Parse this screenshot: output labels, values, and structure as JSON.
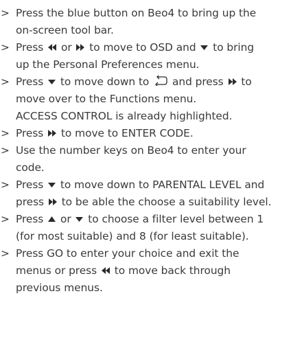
{
  "marker": ">",
  "icons": {
    "rewind": "rewind-double-left-icon",
    "forward": "fast-forward-double-right-icon",
    "down": "down-triangle-icon",
    "up": "up-triangle-icon",
    "functions": "functions-return-arrow-icon"
  },
  "steps": [
    {
      "lines": [
        [
          {
            "t": "Press the blue button on Beo4 to bring up the"
          }
        ],
        [
          {
            "t": "on-screen tool bar."
          }
        ]
      ]
    },
    {
      "lines": [
        [
          {
            "t": "Press "
          },
          {
            "i": "rewind"
          },
          {
            "t": " or "
          },
          {
            "i": "forward"
          },
          {
            "t": " to move to OSD and "
          },
          {
            "i": "down"
          },
          {
            "t": " to bring"
          }
        ],
        [
          {
            "t": "up the Personal Preferences menu."
          }
        ]
      ]
    },
    {
      "lines": [
        [
          {
            "t": "Press "
          },
          {
            "i": "down"
          },
          {
            "t": " to move down to "
          },
          {
            "i": "functions"
          },
          {
            "t": " and press "
          },
          {
            "i": "forward"
          },
          {
            "t": " to"
          }
        ],
        [
          {
            "t": "move over to the Functions menu."
          }
        ],
        [
          {
            "t": "ACCESS CONTROL is already highlighted."
          }
        ]
      ]
    },
    {
      "lines": [
        [
          {
            "t": "Press "
          },
          {
            "i": "forward"
          },
          {
            "t": " to move to ENTER CODE."
          }
        ]
      ]
    },
    {
      "lines": [
        [
          {
            "t": "Use the number keys on Beo4 to enter your"
          }
        ],
        [
          {
            "t": "code."
          }
        ]
      ]
    },
    {
      "lines": [
        [
          {
            "t": "Press "
          },
          {
            "i": "down"
          },
          {
            "t": " to move down to PARENTAL LEVEL and"
          }
        ],
        [
          {
            "t": "press "
          },
          {
            "i": "forward"
          },
          {
            "t": " to be able the choose a suitability level."
          }
        ]
      ]
    },
    {
      "lines": [
        [
          {
            "t": "Press "
          },
          {
            "i": "up"
          },
          {
            "t": " or "
          },
          {
            "i": "down"
          },
          {
            "t": " to choose a filter level between 1"
          }
        ],
        [
          {
            "t": "(for most suitable) and 8 (for least suitable)."
          }
        ]
      ]
    },
    {
      "lines": [
        [
          {
            "t": "Press GO to enter your choice and exit the"
          }
        ],
        [
          {
            "t": "menus or press "
          },
          {
            "i": "rewind"
          },
          {
            "t": " to move back through"
          }
        ],
        [
          {
            "t": "previous menus."
          }
        ]
      ]
    }
  ]
}
